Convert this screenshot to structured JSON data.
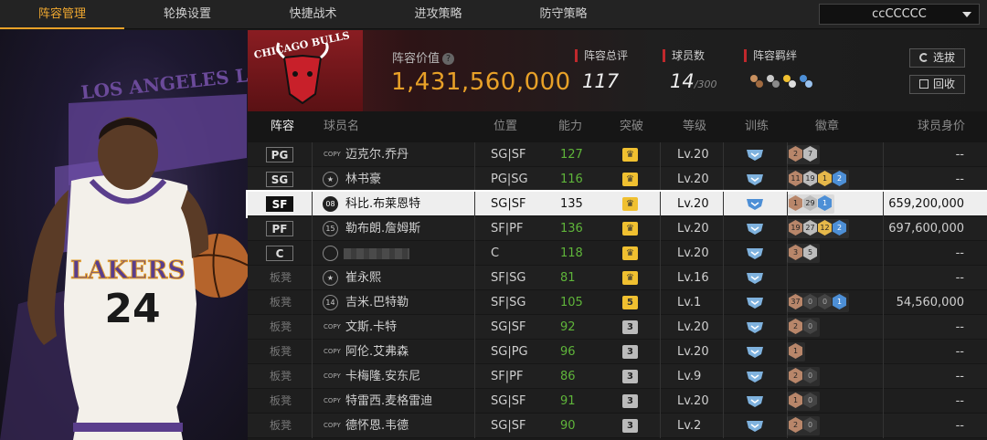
{
  "tabs": [
    {
      "label": "阵容管理",
      "active": true
    },
    {
      "label": "轮换设置"
    },
    {
      "label": "快捷战术"
    },
    {
      "label": "进攻策略"
    },
    {
      "label": "防守策略"
    }
  ],
  "user_select": {
    "value": "ccCCCCC"
  },
  "header": {
    "team_logo_text": "CHICAGO BULLS",
    "lineup_value_label": "阵容价值",
    "lineup_value": "1,431,560,000",
    "total_rating_label": "阵容总评",
    "total_rating": "117",
    "player_count_label": "球员数",
    "player_count": "14",
    "player_count_max": "/300",
    "bonds_label": "阵容羁绊",
    "select_button": "选拔",
    "recycle_button": "回收"
  },
  "art": {
    "team_text": "LOS ANGELES LAKERS",
    "jersey_team": "LAKERS",
    "jersey_number": "24"
  },
  "table": {
    "headers": {
      "lineup": "阵容",
      "name": "球员名",
      "position": "位置",
      "ability": "能力",
      "breakthrough": "突破",
      "level": "等级",
      "training": "训练",
      "badges": "徽章",
      "value": "球员身价"
    },
    "rows": [
      {
        "slot": "PG",
        "bench": false,
        "num": "COPY",
        "name": "迈克尔.乔丹",
        "position": "SG|SF",
        "ability": "127",
        "ability_green": true,
        "brk": "crown",
        "level": "Lv.20",
        "badges": [
          {
            "t": "bronze",
            "v": "2"
          },
          {
            "t": "silver",
            "v": "7"
          }
        ],
        "value": "--"
      },
      {
        "slot": "SG",
        "bench": false,
        "num": "star",
        "name": "林书豪",
        "position": "PG|SG",
        "ability": "116",
        "ability_green": true,
        "brk": "crown",
        "level": "Lv.20",
        "badges": [
          {
            "t": "bronze",
            "v": "11"
          },
          {
            "t": "silver",
            "v": "19"
          },
          {
            "t": "gold",
            "v": "1"
          },
          {
            "t": "blue",
            "v": "2"
          }
        ],
        "value": "--"
      },
      {
        "slot": "SF",
        "bench": false,
        "selected": true,
        "num": "08",
        "name": "科比.布莱恩特",
        "position": "SG|SF",
        "ability": "135",
        "ability_green": false,
        "brk": "crown",
        "level": "Lv.20",
        "badges": [
          {
            "t": "bronze",
            "v": "1"
          },
          {
            "t": "silver",
            "v": "29"
          },
          {
            "t": "blue",
            "v": "1"
          }
        ],
        "value": "659,200,000"
      },
      {
        "slot": "PF",
        "bench": false,
        "num": "15",
        "name": "勒布朗.詹姆斯",
        "position": "SF|PF",
        "ability": "136",
        "ability_green": true,
        "brk": "crown",
        "level": "Lv.20",
        "badges": [
          {
            "t": "bronze",
            "v": "19"
          },
          {
            "t": "silver",
            "v": "27"
          },
          {
            "t": "gold",
            "v": "12"
          },
          {
            "t": "blue",
            "v": "2"
          }
        ],
        "value": "697,600,000"
      },
      {
        "slot": "C",
        "bench": false,
        "num": "blank",
        "name": "",
        "position": "C",
        "ability": "118",
        "ability_green": true,
        "brk": "crown",
        "level": "Lv.20",
        "badges": [
          {
            "t": "bronze",
            "v": "3"
          },
          {
            "t": "silver",
            "v": "5"
          }
        ],
        "value": "--"
      },
      {
        "slot": "板凳",
        "bench": true,
        "num": "star",
        "name": "崔永熙",
        "position": "SF|SG",
        "ability": "81",
        "ability_green": true,
        "brk": "crown",
        "level": "Lv.16",
        "badges": [],
        "value": "--"
      },
      {
        "slot": "板凳",
        "bench": true,
        "num": "14",
        "name": "吉米.巴特勒",
        "position": "SF|SG",
        "ability": "105",
        "ability_green": true,
        "brk": "5",
        "level": "Lv.1",
        "badges": [
          {
            "t": "bronze",
            "v": "37"
          },
          {
            "t": "dark",
            "v": "0"
          },
          {
            "t": "dark",
            "v": "0"
          },
          {
            "t": "blue",
            "v": "1"
          }
        ],
        "value": "54,560,000"
      },
      {
        "slot": "板凳",
        "bench": true,
        "num": "COPY",
        "name": "文斯.卡特",
        "position": "SG|SF",
        "ability": "92",
        "ability_green": true,
        "brk": "3",
        "level": "Lv.20",
        "badges": [
          {
            "t": "bronze",
            "v": "2"
          },
          {
            "t": "dark",
            "v": "0"
          }
        ],
        "value": "--"
      },
      {
        "slot": "板凳",
        "bench": true,
        "num": "COPY",
        "name": "阿伦.艾弗森",
        "position": "SG|PG",
        "ability": "96",
        "ability_green": true,
        "brk": "3",
        "level": "Lv.20",
        "badges": [
          {
            "t": "bronze",
            "v": "1"
          }
        ],
        "value": "--"
      },
      {
        "slot": "板凳",
        "bench": true,
        "num": "COPY",
        "name": "卡梅隆.安东尼",
        "position": "SF|PF",
        "ability": "86",
        "ability_green": true,
        "brk": "3",
        "level": "Lv.9",
        "badges": [
          {
            "t": "bronze",
            "v": "2"
          },
          {
            "t": "dark",
            "v": "0"
          }
        ],
        "value": "--"
      },
      {
        "slot": "板凳",
        "bench": true,
        "num": "COPY",
        "name": "特雷西.麦格雷迪",
        "position": "SG|SF",
        "ability": "91",
        "ability_green": true,
        "brk": "3",
        "level": "Lv.20",
        "badges": [
          {
            "t": "bronze",
            "v": "1"
          },
          {
            "t": "dark",
            "v": "0"
          }
        ],
        "value": "--"
      },
      {
        "slot": "板凳",
        "bench": true,
        "num": "COPY",
        "name": "德怀恩.韦德",
        "position": "SG|SF",
        "ability": "90",
        "ability_green": true,
        "brk": "3",
        "level": "Lv.2",
        "badges": [
          {
            "t": "bronze",
            "v": "2"
          },
          {
            "t": "dark",
            "v": "0"
          }
        ],
        "value": "--"
      }
    ]
  },
  "colors": {
    "accent": "#e8a128",
    "ability_green": "#5fb53a",
    "header_red": "#c0282c"
  }
}
